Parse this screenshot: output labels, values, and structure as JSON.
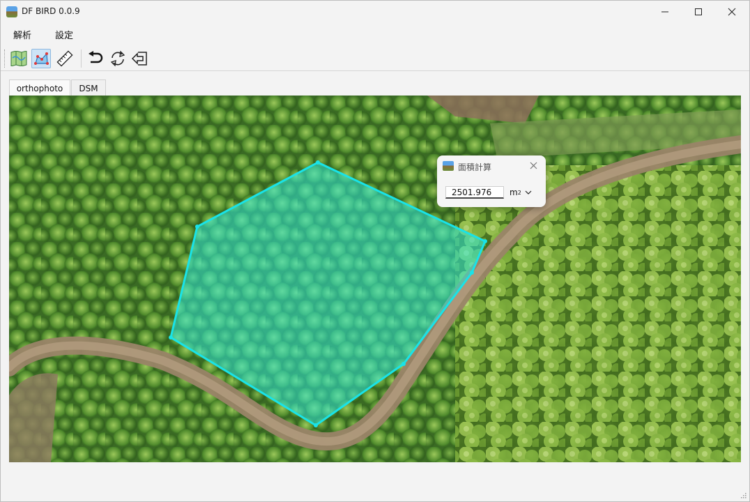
{
  "window": {
    "title": "DF BIRD 0.0.9",
    "app_icon": "app-landscape-icon",
    "controls": {
      "minimize": "minimize-icon",
      "maximize": "maximize-icon",
      "close": "close-icon"
    }
  },
  "menu": {
    "items": [
      "解析",
      "設定"
    ]
  },
  "toolbar": {
    "buttons": [
      {
        "icon": "map-icon",
        "active": false
      },
      {
        "icon": "polygon-area-icon",
        "active": true
      },
      {
        "icon": "ruler-icon",
        "active": false
      },
      {
        "icon": "undo-icon",
        "active": false
      },
      {
        "icon": "refresh-icon",
        "active": false
      },
      {
        "icon": "exit-icon",
        "active": false
      }
    ]
  },
  "tabs": [
    {
      "label": "orthophoto",
      "selected": true
    },
    {
      "label": "DSM",
      "selected": false
    }
  ],
  "dialog": {
    "title": "面積計算",
    "value": "2501.976",
    "unit": "m",
    "unit_superscript": "2"
  },
  "colors": {
    "polygon_stroke": "#19e3e8",
    "polygon_fill": "#2fe8d8",
    "active_tool_bg": "#cde4f7"
  }
}
